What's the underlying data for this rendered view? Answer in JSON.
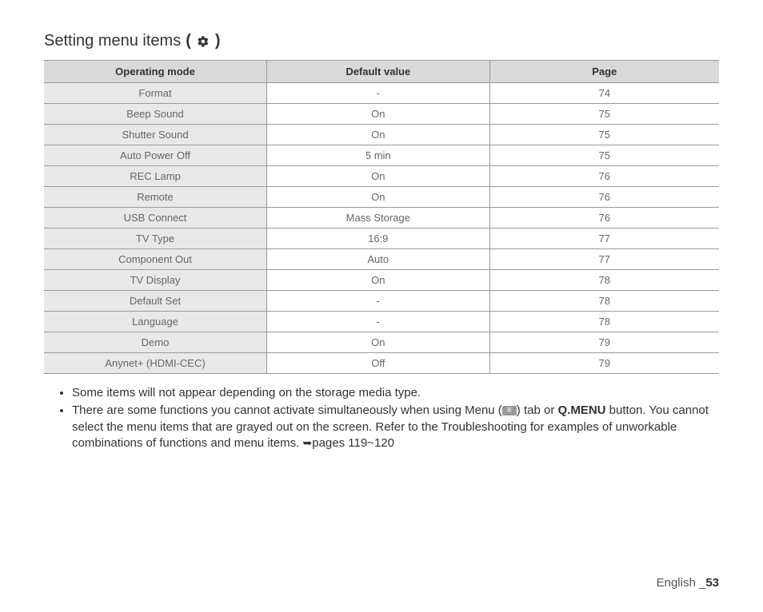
{
  "heading": "Setting menu items",
  "heading_paren_open": "(",
  "heading_paren_close": ")",
  "table": {
    "headers": [
      "Operating mode",
      "Default value",
      "Page"
    ],
    "rows": [
      {
        "mode": "Format",
        "default": "-",
        "page": "74"
      },
      {
        "mode": "Beep Sound",
        "default": "On",
        "page": "75"
      },
      {
        "mode": "Shutter Sound",
        "default": "On",
        "page": "75"
      },
      {
        "mode": "Auto Power Off",
        "default": "5 min",
        "page": "75"
      },
      {
        "mode": "REC Lamp",
        "default": "On",
        "page": "76"
      },
      {
        "mode": "Remote",
        "default": "On",
        "page": "76"
      },
      {
        "mode": "USB Connect",
        "default": "Mass Storage",
        "page": "76"
      },
      {
        "mode": "TV Type",
        "default": "16:9",
        "page": "77"
      },
      {
        "mode": "Component Out",
        "default": "Auto",
        "page": "77"
      },
      {
        "mode": "TV Display",
        "default": "On",
        "page": "78"
      },
      {
        "mode": "Default Set",
        "default": "-",
        "page": "78"
      },
      {
        "mode": "Language",
        "default": "-",
        "page": "78"
      },
      {
        "mode": "Demo",
        "default": "On",
        "page": "79"
      },
      {
        "mode": "Anynet+ (HDMI-CEC)",
        "default": "Off",
        "page": "79"
      }
    ]
  },
  "notes": {
    "item1": "Some items will not appear depending on the storage media type.",
    "item2_part1": "There are some functions you cannot activate simultaneously when using Menu (",
    "item2_part2": ") tab or ",
    "item2_qmenu": "Q.MENU",
    "item2_part3": " button. You cannot select the menu items that are grayed out on the screen. Refer to the Troubleshooting for examples of unworkable combinations of functions and menu items. ",
    "item2_pages": "pages 119~120"
  },
  "footer": {
    "lang": "English ",
    "sep": "_",
    "page": "53"
  }
}
